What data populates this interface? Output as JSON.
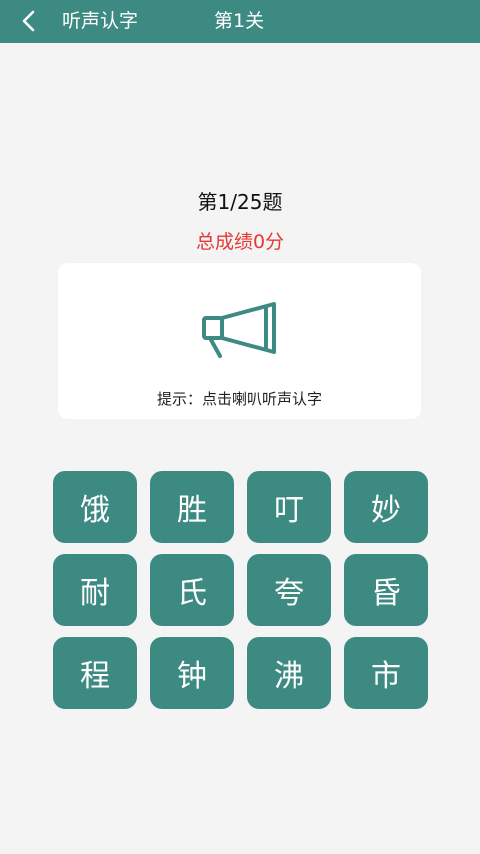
{
  "header": {
    "title": "听声认字",
    "level": "第1关"
  },
  "quiz": {
    "progress": "第1/25题",
    "score": "总成绩0分",
    "hint": "提示：点击喇叭听声认字"
  },
  "choices": [
    "饿",
    "胜",
    "叮",
    "妙",
    "耐",
    "氏",
    "夸",
    "昏",
    "程",
    "钟",
    "沸",
    "市"
  ],
  "colors": {
    "accent": "#3d8a82",
    "score": "#e53935",
    "background": "#f4f4f4"
  },
  "icons": {
    "back": "chevron-left-icon",
    "speaker": "megaphone-icon"
  }
}
